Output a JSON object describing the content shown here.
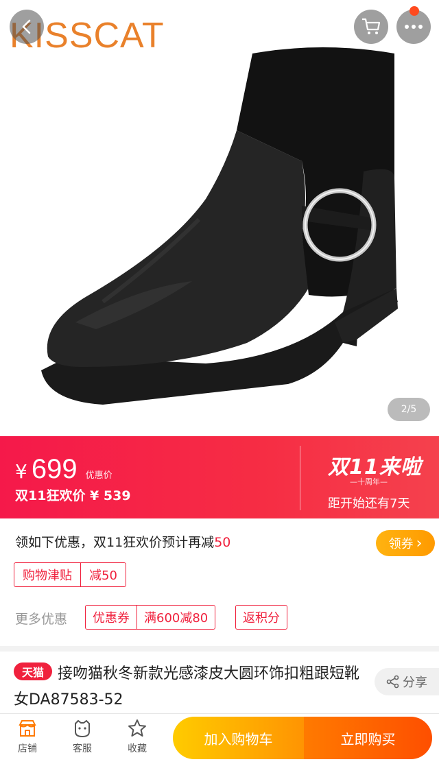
{
  "hero": {
    "brand": "KISSCAT",
    "pager": "2/5",
    "icons": {
      "back": "back-arrow-icon",
      "cart": "cart-icon",
      "more": "more-dots-icon"
    }
  },
  "price": {
    "currency": "¥",
    "amount": "699",
    "tag": "优惠价",
    "festival_price": "双11狂欢价 ¥ 539",
    "festival_logo": "双11来啦",
    "festival_sub": "—十周年—",
    "countdown": "距开始还有7天"
  },
  "coupon": {
    "title_prefix": "领如下优惠，双11狂欢价预计再减",
    "title_amount": "50",
    "claim_button": "领券",
    "claim_arrow": "›",
    "allowance_label": "购物津贴",
    "allowance_value": "减50",
    "more_label": "更多优惠",
    "coupon_tag": "优惠券",
    "coupon_value": "满600减80",
    "points_tag": "返积分"
  },
  "product": {
    "badge": "天猫",
    "title": "接吻猫秋冬新款光感漆皮大圆环饰扣粗跟短靴女DA87583-52",
    "share": "分享"
  },
  "bottom": {
    "shop": "店铺",
    "service": "客服",
    "favorite": "收藏",
    "add_to_cart": "加入购物车",
    "buy_now": "立即购买"
  },
  "colors": {
    "brand": "#e9812b",
    "banner": "#f62d44",
    "accent": "#f0213d",
    "cart_button": "#ffb000",
    "buy_button": "#fe5a00"
  }
}
